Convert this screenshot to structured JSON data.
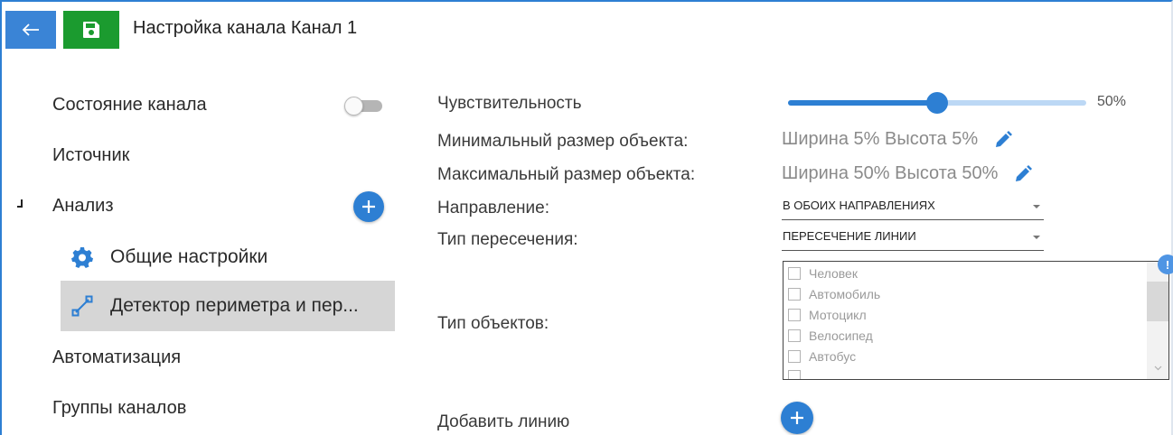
{
  "header": {
    "title": "Настройка канала Канал 1",
    "back_icon": "arrow-left-icon",
    "save_icon": "floppy-disk-icon"
  },
  "sidebar": {
    "items": [
      {
        "label": "Состояние канала"
      },
      {
        "label": "Источник"
      },
      {
        "label": "Анализ"
      },
      {
        "label": "Автоматизация"
      },
      {
        "label": "Группы каналов"
      }
    ],
    "channel_state_enabled": false,
    "sub_items": [
      {
        "label": "Общие настройки",
        "icon": "gear-icon"
      },
      {
        "label": "Детектор периметра и пер...",
        "icon": "line-segment-icon",
        "selected": true
      }
    ]
  },
  "form": {
    "sensitivity": {
      "label": "Чувствительность",
      "value": 50,
      "value_text": "50%"
    },
    "min_size": {
      "label": "Минимальный размер объекта:",
      "value": "Ширина 5% Высота 5%"
    },
    "max_size": {
      "label": "Максимальный размер объекта:",
      "value": "Ширина 50% Высота 50%"
    },
    "direction": {
      "label": "Направление:",
      "value": "В ОБОИХ НАПРАВЛЕНИЯХ"
    },
    "crossing_type": {
      "label": "Тип пересечения:",
      "value": "ПЕРЕСЕЧЕНИЕ ЛИНИИ"
    },
    "object_types": {
      "label": "Тип объектов:",
      "options": [
        "Человек",
        "Автомобиль",
        "Мотоцикл",
        "Велосипед",
        "Автобус"
      ],
      "badge": "!"
    },
    "add_line": {
      "label": "Добавить линию"
    }
  },
  "colors": {
    "accent": "#2d7fd3",
    "save_green": "#1b9b2f",
    "selected_bg": "#d6d6d6"
  }
}
